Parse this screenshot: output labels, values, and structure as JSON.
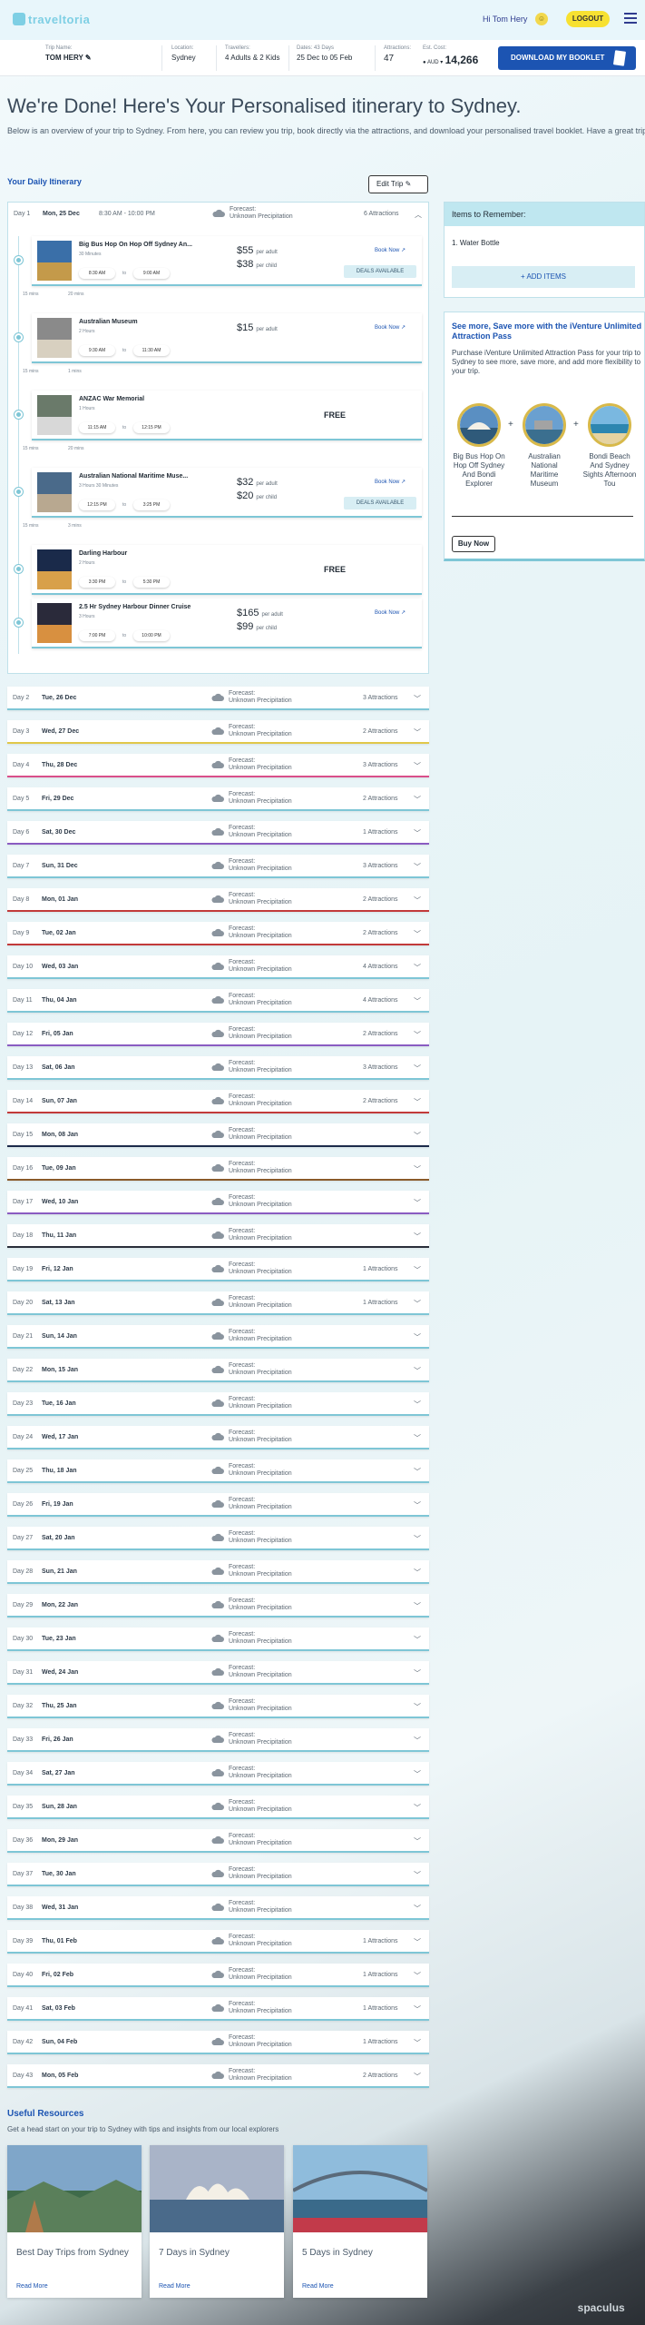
{
  "header": {
    "logo_text": "traveltoria",
    "greeting": "Hi Tom Hery",
    "logout_label": "LOGOUT"
  },
  "trip_bar": {
    "trip_name_label": "Trip Name:",
    "trip_name": "TOM HERY",
    "location_label": "Location:",
    "location": "Sydney",
    "travellers_label": "Travellers:",
    "travellers": "4 Adults & 2 Kids",
    "dates_label": "Dates: 43 Days",
    "dates": "25 Dec to 05 Feb",
    "attractions_label": "Attractions:",
    "attractions": "47",
    "cost_label": "Est. Cost:",
    "currency": "AUD",
    "cost": "14,266",
    "download_label": "DOWNLOAD MY BOOKLET"
  },
  "page": {
    "title": "We're Done! Here's Your Personalised itinerary to Sydney.",
    "intro": "Below is an overview of your trip to Sydney. From here, you can review you trip, book directly via the attractions, and download your personalised travel booklet. Have a great trip!",
    "itinerary_heading": "Your Daily Itinerary",
    "edit_trip_label": "Edit Trip"
  },
  "forecast": {
    "label": "Forecast:",
    "value": "Unknown Precipitation"
  },
  "day1": {
    "num": "Day 1",
    "date": "Mon, 25 Dec",
    "time": "8:30 AM - 10:00 PM",
    "attractions": "6 Attractions",
    "activities": [
      {
        "name": "Big Bus Hop On Hop Off Sydney An...",
        "duration": "30 Minutes",
        "start": "8:30 AM",
        "to": "to",
        "end": "9:00 AM",
        "price1": "$55",
        "unit1": "per adult",
        "price2": "$38",
        "unit2": "per child",
        "book": "Book Now",
        "deals": "DEALS AVAILABLE"
      },
      {
        "name": "Australian Museum",
        "duration": "2 Hours",
        "start": "9:30 AM",
        "to": "to",
        "end": "11:30 AM",
        "price1": "$15",
        "unit1": "per adult",
        "book": "Book Now"
      },
      {
        "name": "ANZAC War Memorial",
        "duration": "1 Hours",
        "start": "11:15 AM",
        "to": "to",
        "end": "12:15 PM",
        "free": "FREE"
      },
      {
        "name": "Australian National Maritime Muse...",
        "duration": "3 Hours 30 Minutes",
        "start": "12:15 PM",
        "to": "to",
        "end": "3:25 PM",
        "price1": "$32",
        "unit1": "per adult",
        "price2": "$20",
        "unit2": "per child",
        "book": "Book Now",
        "deals": "DEALS AVAILABLE"
      },
      {
        "name": "Darling Harbour",
        "duration": "2 Hours",
        "start": "3:30 PM",
        "to": "to",
        "end": "5:30 PM",
        "free": "FREE"
      },
      {
        "name": "2.5 Hr Sydney Harbour Dinner Cruise",
        "duration": "3 Hours",
        "start": "7:00 PM",
        "to": "to",
        "end": "10:00 PM",
        "price1": "$165",
        "unit1": "per adult",
        "price2": "$99",
        "unit2": "per child",
        "book": "Book Now"
      }
    ],
    "transfers": [
      {
        "a": "15 mins",
        "b": "20 mins"
      },
      {
        "a": "15 mins",
        "b": "1 mins"
      },
      {
        "a": "15 mins",
        "b": "20 mins"
      },
      {
        "a": "15 mins",
        "b": "3 mins"
      }
    ]
  },
  "days": [
    {
      "num": "Day 2",
      "date": "Tue, 26 Dec",
      "attractions": "3 Attractions",
      "color": "#7ec6d6"
    },
    {
      "num": "Day 3",
      "date": "Wed, 27 Dec",
      "attractions": "2 Attractions",
      "color": "#e0c84a"
    },
    {
      "num": "Day 4",
      "date": "Thu, 28 Dec",
      "attractions": "3 Attractions",
      "color": "#d94f8a"
    },
    {
      "num": "Day 5",
      "date": "Fri, 29 Dec",
      "attractions": "2 Attractions",
      "color": "#7ec6d6"
    },
    {
      "num": "Day 6",
      "date": "Sat, 30 Dec",
      "attractions": "1 Attractions",
      "color": "#8a5cc2"
    },
    {
      "num": "Day 7",
      "date": "Sun, 31 Dec",
      "attractions": "3 Attractions",
      "color": "#7ec6d6"
    },
    {
      "num": "Day 8",
      "date": "Mon, 01 Jan",
      "attractions": "2 Attractions",
      "color": "#c23a3a"
    },
    {
      "num": "Day 9",
      "date": "Tue, 02 Jan",
      "attractions": "2 Attractions",
      "color": "#c23a3a"
    },
    {
      "num": "Day 10",
      "date": "Wed, 03 Jan",
      "attractions": "4 Attractions",
      "color": "#7ec6d6"
    },
    {
      "num": "Day 11",
      "date": "Thu, 04 Jan",
      "attractions": "4 Attractions",
      "color": "#7ec6d6"
    },
    {
      "num": "Day 12",
      "date": "Fri, 05 Jan",
      "attractions": "2 Attractions",
      "color": "#8a5cc2"
    },
    {
      "num": "Day 13",
      "date": "Sat, 06 Jan",
      "attractions": "3 Attractions",
      "color": "#7ec6d6"
    },
    {
      "num": "Day 14",
      "date": "Sun, 07 Jan",
      "attractions": "2 Attractions",
      "color": "#c23a3a"
    },
    {
      "num": "Day 15",
      "date": "Mon, 08 Jan",
      "attractions": "",
      "color": "#1c2a4a"
    },
    {
      "num": "Day 16",
      "date": "Tue, 09 Jan",
      "attractions": "",
      "color": "#8a5a2a"
    },
    {
      "num": "Day 17",
      "date": "Wed, 10 Jan",
      "attractions": "",
      "color": "#8a5cc2"
    },
    {
      "num": "Day 18",
      "date": "Thu, 11 Jan",
      "attractions": "",
      "color": "#2a2e3a"
    },
    {
      "num": "Day 19",
      "date": "Fri, 12 Jan",
      "attractions": "1 Attractions",
      "color": "#7ec6d6"
    },
    {
      "num": "Day 20",
      "date": "Sat, 13 Jan",
      "attractions": "1 Attractions",
      "color": "#7ec6d6"
    },
    {
      "num": "Day 21",
      "date": "Sun, 14 Jan",
      "attractions": "",
      "color": "#7ec6d6"
    },
    {
      "num": "Day 22",
      "date": "Mon, 15 Jan",
      "attractions": "",
      "color": "#7ec6d6"
    },
    {
      "num": "Day 23",
      "date": "Tue, 16 Jan",
      "attractions": "",
      "color": "#7ec6d6"
    },
    {
      "num": "Day 24",
      "date": "Wed, 17 Jan",
      "attractions": "",
      "color": "#7ec6d6"
    },
    {
      "num": "Day 25",
      "date": "Thu, 18 Jan",
      "attractions": "",
      "color": "#7ec6d6"
    },
    {
      "num": "Day 26",
      "date": "Fri, 19 Jan",
      "attractions": "",
      "color": "#7ec6d6"
    },
    {
      "num": "Day 27",
      "date": "Sat, 20 Jan",
      "attractions": "",
      "color": "#7ec6d6"
    },
    {
      "num": "Day 28",
      "date": "Sun, 21 Jan",
      "attractions": "",
      "color": "#7ec6d6"
    },
    {
      "num": "Day 29",
      "date": "Mon, 22 Jan",
      "attractions": "",
      "color": "#7ec6d6"
    },
    {
      "num": "Day 30",
      "date": "Tue, 23 Jan",
      "attractions": "",
      "color": "#7ec6d6"
    },
    {
      "num": "Day 31",
      "date": "Wed, 24 Jan",
      "attractions": "",
      "color": "#7ec6d6"
    },
    {
      "num": "Day 32",
      "date": "Thu, 25 Jan",
      "attractions": "",
      "color": "#7ec6d6"
    },
    {
      "num": "Day 33",
      "date": "Fri, 26 Jan",
      "attractions": "",
      "color": "#7ec6d6"
    },
    {
      "num": "Day 34",
      "date": "Sat, 27 Jan",
      "attractions": "",
      "color": "#7ec6d6"
    },
    {
      "num": "Day 35",
      "date": "Sun, 28 Jan",
      "attractions": "",
      "color": "#7ec6d6"
    },
    {
      "num": "Day 36",
      "date": "Mon, 29 Jan",
      "attractions": "",
      "color": "#7ec6d6"
    },
    {
      "num": "Day 37",
      "date": "Tue, 30 Jan",
      "attractions": "",
      "color": "#7ec6d6"
    },
    {
      "num": "Day 38",
      "date": "Wed, 31 Jan",
      "attractions": "",
      "color": "#7ec6d6"
    },
    {
      "num": "Day 39",
      "date": "Thu, 01 Feb",
      "attractions": "1 Attractions",
      "color": "#7ec6d6"
    },
    {
      "num": "Day 40",
      "date": "Fri, 02 Feb",
      "attractions": "1 Attractions",
      "color": "#7ec6d6"
    },
    {
      "num": "Day 41",
      "date": "Sat, 03 Feb",
      "attractions": "1 Attractions",
      "color": "#7ec6d6"
    },
    {
      "num": "Day 42",
      "date": "Sun, 04 Feb",
      "attractions": "1 Attractions",
      "color": "#7ec6d6"
    },
    {
      "num": "Day 43",
      "date": "Mon, 05 Feb",
      "attractions": "2 Attractions",
      "color": "#7ec6d6"
    }
  ],
  "remember": {
    "title": "Items to Remember:",
    "item": "1. Water Bottle",
    "add_label": "+ ADD ITEMS"
  },
  "pass": {
    "title": "See more, Save more with the iVenture Unlimited Attraction Pass",
    "desc": "Purchase iVenture Unlimited Attraction Pass for your trip to Sydney to see more, save more, and add more flexibility to your trip.",
    "attractions": [
      "Big Bus Hop On Hop Off Sydney And Bondi Explorer",
      "Australian National Maritime Museum",
      "Bondi Beach And Sydney Sights Afternoon Tou"
    ],
    "plus": "+",
    "buy_label": "Buy Now"
  },
  "resources": {
    "heading": "Useful Resources",
    "sub": "Get a head start on your trip to Sydney with tips and insights from our local explorers",
    "cards": [
      {
        "title": "Best Day Trips from Sydney",
        "read": "Read More"
      },
      {
        "title": "7 Days in Sydney",
        "read": "Read More"
      },
      {
        "title": "5 Days in Sydney",
        "read": "Read More"
      }
    ]
  },
  "footer": {
    "logo": "spaculus"
  },
  "colors": {
    "accent": "#1c54b2",
    "teal": "#7ec6d6",
    "yellow": "#f7e131"
  }
}
